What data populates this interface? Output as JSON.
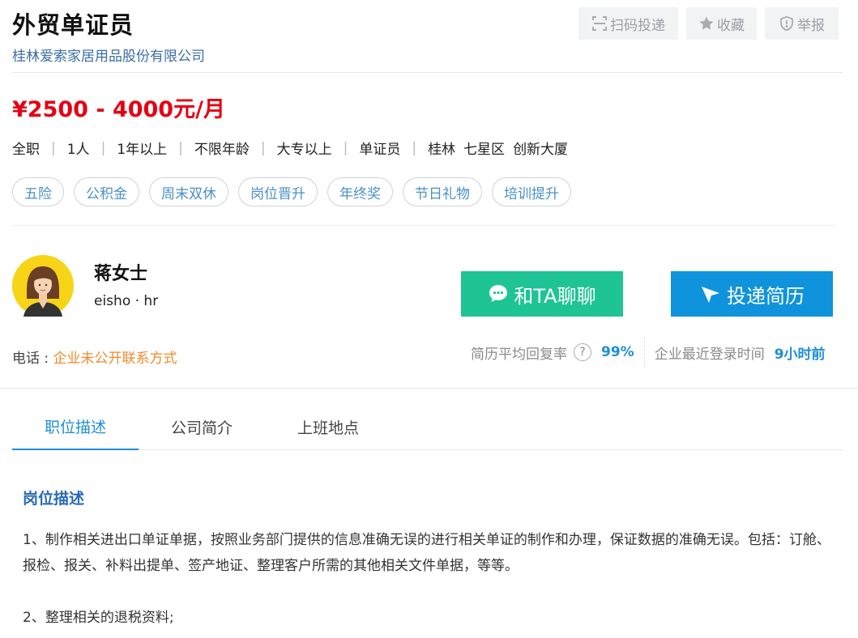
{
  "job": {
    "title": "外贸单证员",
    "company": "桂林爱索家居用品股份有限公司",
    "salary": "¥2500 - 4000元/月",
    "meta": [
      "全职",
      "1人",
      "1年以上",
      "不限年龄",
      "大专以上",
      "单证员"
    ],
    "location": [
      "桂林",
      "七星区",
      "创新大厦"
    ],
    "tags": [
      "五险",
      "公积金",
      "周末双休",
      "岗位晋升",
      "年终奖",
      "节日礼物",
      "培训提升"
    ]
  },
  "actions": {
    "scan_label": "扫码投递",
    "fav_label": "收藏",
    "report_label": "举报"
  },
  "hr": {
    "name": "蒋女士",
    "role": "eisho · hr",
    "chat_label": "和TA聊聊",
    "apply_label": "投递简历",
    "phone_label": "电话 : ",
    "phone_value": "企业未公开联系方式"
  },
  "stats": {
    "reply_label": "简历平均回复率",
    "reply_help": "?",
    "reply_value": "99%",
    "login_label": "企业最近登录时间",
    "login_value": "9小时前"
  },
  "tabs": [
    "职位描述",
    "公司简介",
    "上班地点"
  ],
  "description": {
    "section_title": "岗位描述",
    "lines": [
      "1、制作相关进出口单证单据，按照业务部门提供的信息准确无误的进行相关单证的制作和办理，保证数据的准确无误。包括：订舱、报检、报关、补料出提单、签产地证、整理客户所需的其他相关文件单据，等等。",
      "2、整理相关的退税资料;"
    ]
  },
  "colors": {
    "salary": "#e60012",
    "chat_button": "#1fc495",
    "apply_button": "#0f93dc",
    "accent": "#1e8fd6",
    "phone_value": "#f08a2b"
  }
}
